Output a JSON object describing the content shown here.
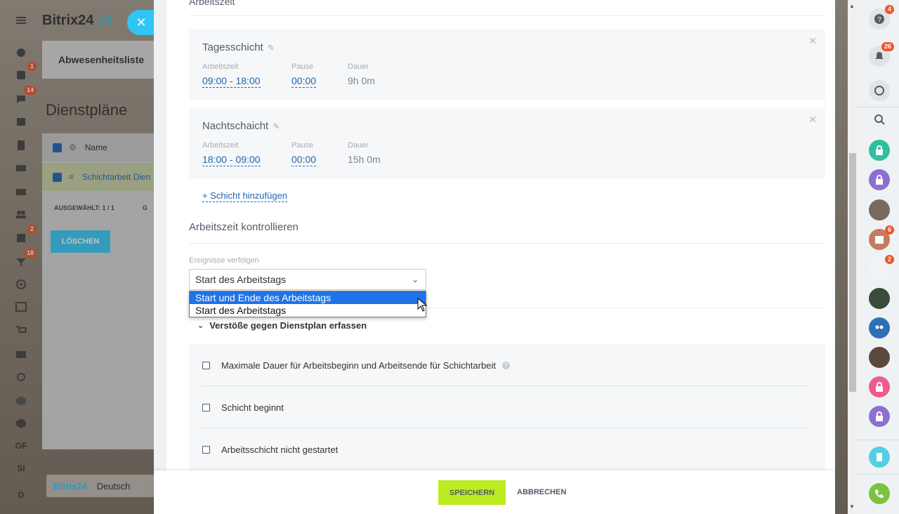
{
  "app": {
    "logo": "Bitrix24",
    "logo_suffix": "24"
  },
  "left_rail": {
    "badges": {
      "tasks": "1",
      "chat": "14",
      "tasks2": "2",
      "filter": "18"
    },
    "text_items": [
      "GF",
      "SI",
      "D"
    ]
  },
  "underlying": {
    "tab": "Abwesenheitsliste",
    "page_title": "Dienstpläne",
    "grid_header": "Name",
    "grid_row": "Schichtarbeit Dien",
    "selected": "AUSGEWÄHLT: 1 / 1",
    "selected_extra": "G",
    "delete_button": "LÖSCHEN",
    "footer_logo": "Bitrix24",
    "footer_lang": "Deutsch"
  },
  "slider": {
    "top_section": "Arbeitszeit",
    "shifts": [
      {
        "name": "Tagesschicht",
        "work_label": "Arbeitszeit",
        "work_value": "09:00 - 18:00",
        "pause_label": "Pause",
        "pause_value": "00:00",
        "duration_label": "Dauer",
        "duration_value": "9h 0m"
      },
      {
        "name": "Nachtschaicht",
        "work_label": "Arbeitszeit",
        "work_value": "18:00 - 09:00",
        "pause_label": "Pause",
        "pause_value": "00:00",
        "duration_label": "Dauer",
        "duration_value": "15h 0m"
      }
    ],
    "add_shift": "+ Schicht hinzufügen",
    "control_section": "Arbeitszeit kontrollieren",
    "events_label": "Ereignisse verfolgen",
    "events_value": "Start des Arbeitstags",
    "events_options": [
      "Start und Ende des Arbeitstags",
      "Start des Arbeitstags"
    ],
    "violations_title": "Verstöße gegen Dienstplan erfassen",
    "violations": [
      "Maximale Dauer für Arbeitsbeginn und Arbeitsende für Schichtarbeit",
      "Schicht beginnt",
      "Arbeitsschicht nicht gestartet"
    ],
    "save_button": "SPEICHERN",
    "cancel_button": "ABBRECHEN"
  },
  "right_rail": {
    "badges": {
      "help": "4",
      "notifications": "26",
      "calendar": "6",
      "group": "2"
    }
  },
  "colors": {
    "accent": "#2fc6f6",
    "link": "#2067b0",
    "save": "#bbed21",
    "badge": "#f0562a"
  }
}
